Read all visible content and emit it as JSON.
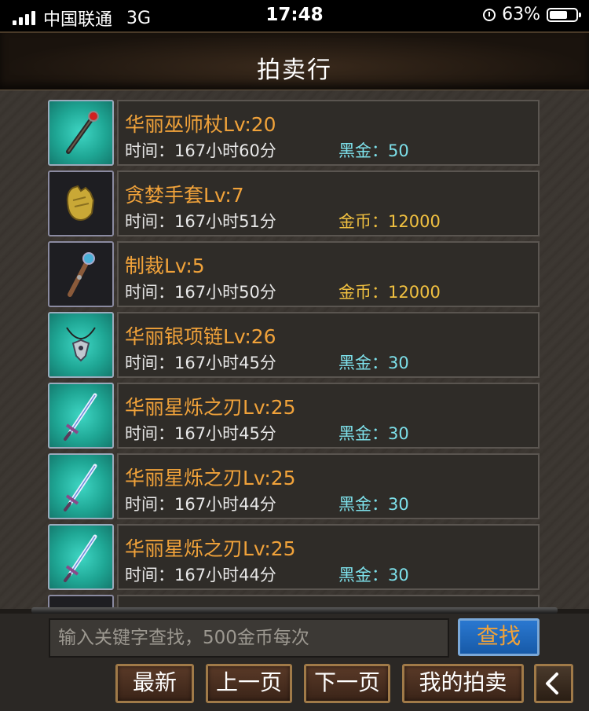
{
  "status_bar": {
    "carrier": "中国联通",
    "network": "3G",
    "time": "17:48",
    "battery": "63%"
  },
  "header": {
    "title": "拍卖行"
  },
  "items": [
    {
      "name": "华丽巫师杖Lv:20",
      "time": "时间：167小时60分",
      "price": "黑金：50",
      "currency": "black",
      "icon": "staff-icon",
      "bg": "teal"
    },
    {
      "name": "贪婪手套Lv:7",
      "time": "时间：167小时51分",
      "price": "金币：12000",
      "currency": "gold",
      "icon": "gloves-icon",
      "bg": "dark"
    },
    {
      "name": "制裁Lv:5",
      "time": "时间：167小时50分",
      "price": "金币：12000",
      "currency": "gold",
      "icon": "mace-icon",
      "bg": "dark"
    },
    {
      "name": "华丽银项链Lv:26",
      "time": "时间：167小时45分",
      "price": "黑金：30",
      "currency": "black",
      "icon": "necklace-icon",
      "bg": "teal"
    },
    {
      "name": "华丽星烁之刃Lv:25",
      "time": "时间：167小时45分",
      "price": "黑金：30",
      "currency": "black",
      "icon": "sword-icon",
      "bg": "teal"
    },
    {
      "name": "华丽星烁之刃Lv:25",
      "time": "时间：167小时44分",
      "price": "黑金：30",
      "currency": "black",
      "icon": "sword-icon",
      "bg": "teal"
    },
    {
      "name": "华丽星烁之刃Lv:25",
      "time": "时间：167小时44分",
      "price": "黑金：30",
      "currency": "black",
      "icon": "sword-icon",
      "bg": "teal"
    },
    {
      "name": "",
      "time": "",
      "price": "",
      "currency": "black",
      "icon": "helmet-icon",
      "bg": "dark"
    }
  ],
  "search": {
    "placeholder": "输入关键字查找，500金币每次",
    "button": "查找"
  },
  "nav": {
    "latest": "最新",
    "prev": "上一页",
    "next": "下一页",
    "mine": "我的拍卖"
  },
  "colors": {
    "item_name": "#f0a23a",
    "black_gold": "#7de0ea",
    "gold_coin": "#f0c040",
    "teal_bg": "#1fa795"
  }
}
